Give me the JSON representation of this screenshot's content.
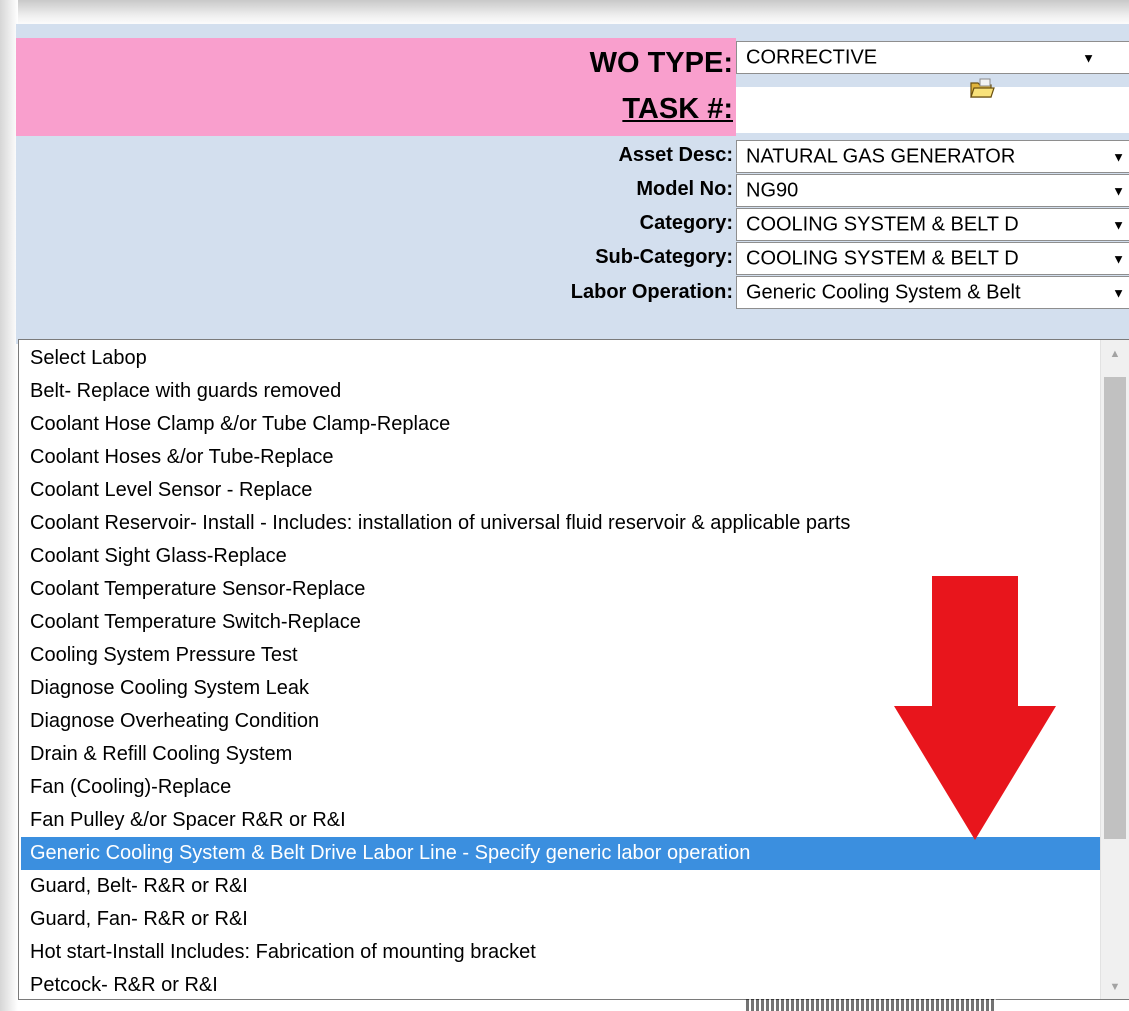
{
  "form": {
    "wo_type": {
      "label": "WO TYPE:",
      "value": "CORRECTIVE"
    },
    "task": {
      "label": "TASK #:"
    },
    "asset_desc": {
      "label": "Asset Desc:",
      "value": "NATURAL GAS GENERATOR"
    },
    "model_no": {
      "label": "Model No:",
      "value": "NG90"
    },
    "category": {
      "label": "Category:",
      "value": "COOLING SYSTEM & BELT D"
    },
    "sub_category": {
      "label": "Sub-Category:",
      "value": "COOLING SYSTEM & BELT D"
    },
    "labor_operation": {
      "label": "Labor Operation:",
      "value": "Generic Cooling System & Belt"
    }
  },
  "labop_list": {
    "selected_index": 16,
    "items": [
      "Select Labop",
      "Belt- Replace with guards removed",
      "Coolant Hose Clamp &/or Tube Clamp-Replace",
      "Coolant Hoses &/or Tube-Replace",
      "Coolant Level Sensor - Replace",
      "Coolant Reservoir- Install - Includes: installation of universal fluid reservoir & applicable parts",
      "Coolant Sight Glass-Replace",
      "Coolant Temperature Sensor-Replace",
      "Coolant Temperature Switch-Replace",
      "Cooling System Pressure Test",
      "Diagnose Cooling System Leak",
      "Diagnose Overheating Condition",
      "Drain & Refill Cooling System",
      "Fan (Cooling)-Replace",
      "Fan Pulley &/or Spacer R&R or R&I",
      "Generic Cooling System & Belt Drive Labor Line - Specify generic labor operation",
      "Guard, Belt- R&R or R&I",
      "Guard, Fan- R&R or R&I",
      "Hot start-Install Includes: Fabrication of mounting bracket",
      "Petcock- R&R or R&I"
    ]
  },
  "icons": {
    "dropdown": "triangle-down-icon",
    "task_lookup": "folder-open-icon",
    "annotation": "red-down-arrow-icon"
  },
  "colors": {
    "label_band": "#f99fcd",
    "form_bg": "#d3dfee",
    "highlight": "#3b8fdf",
    "annotation": "#e8151c"
  }
}
